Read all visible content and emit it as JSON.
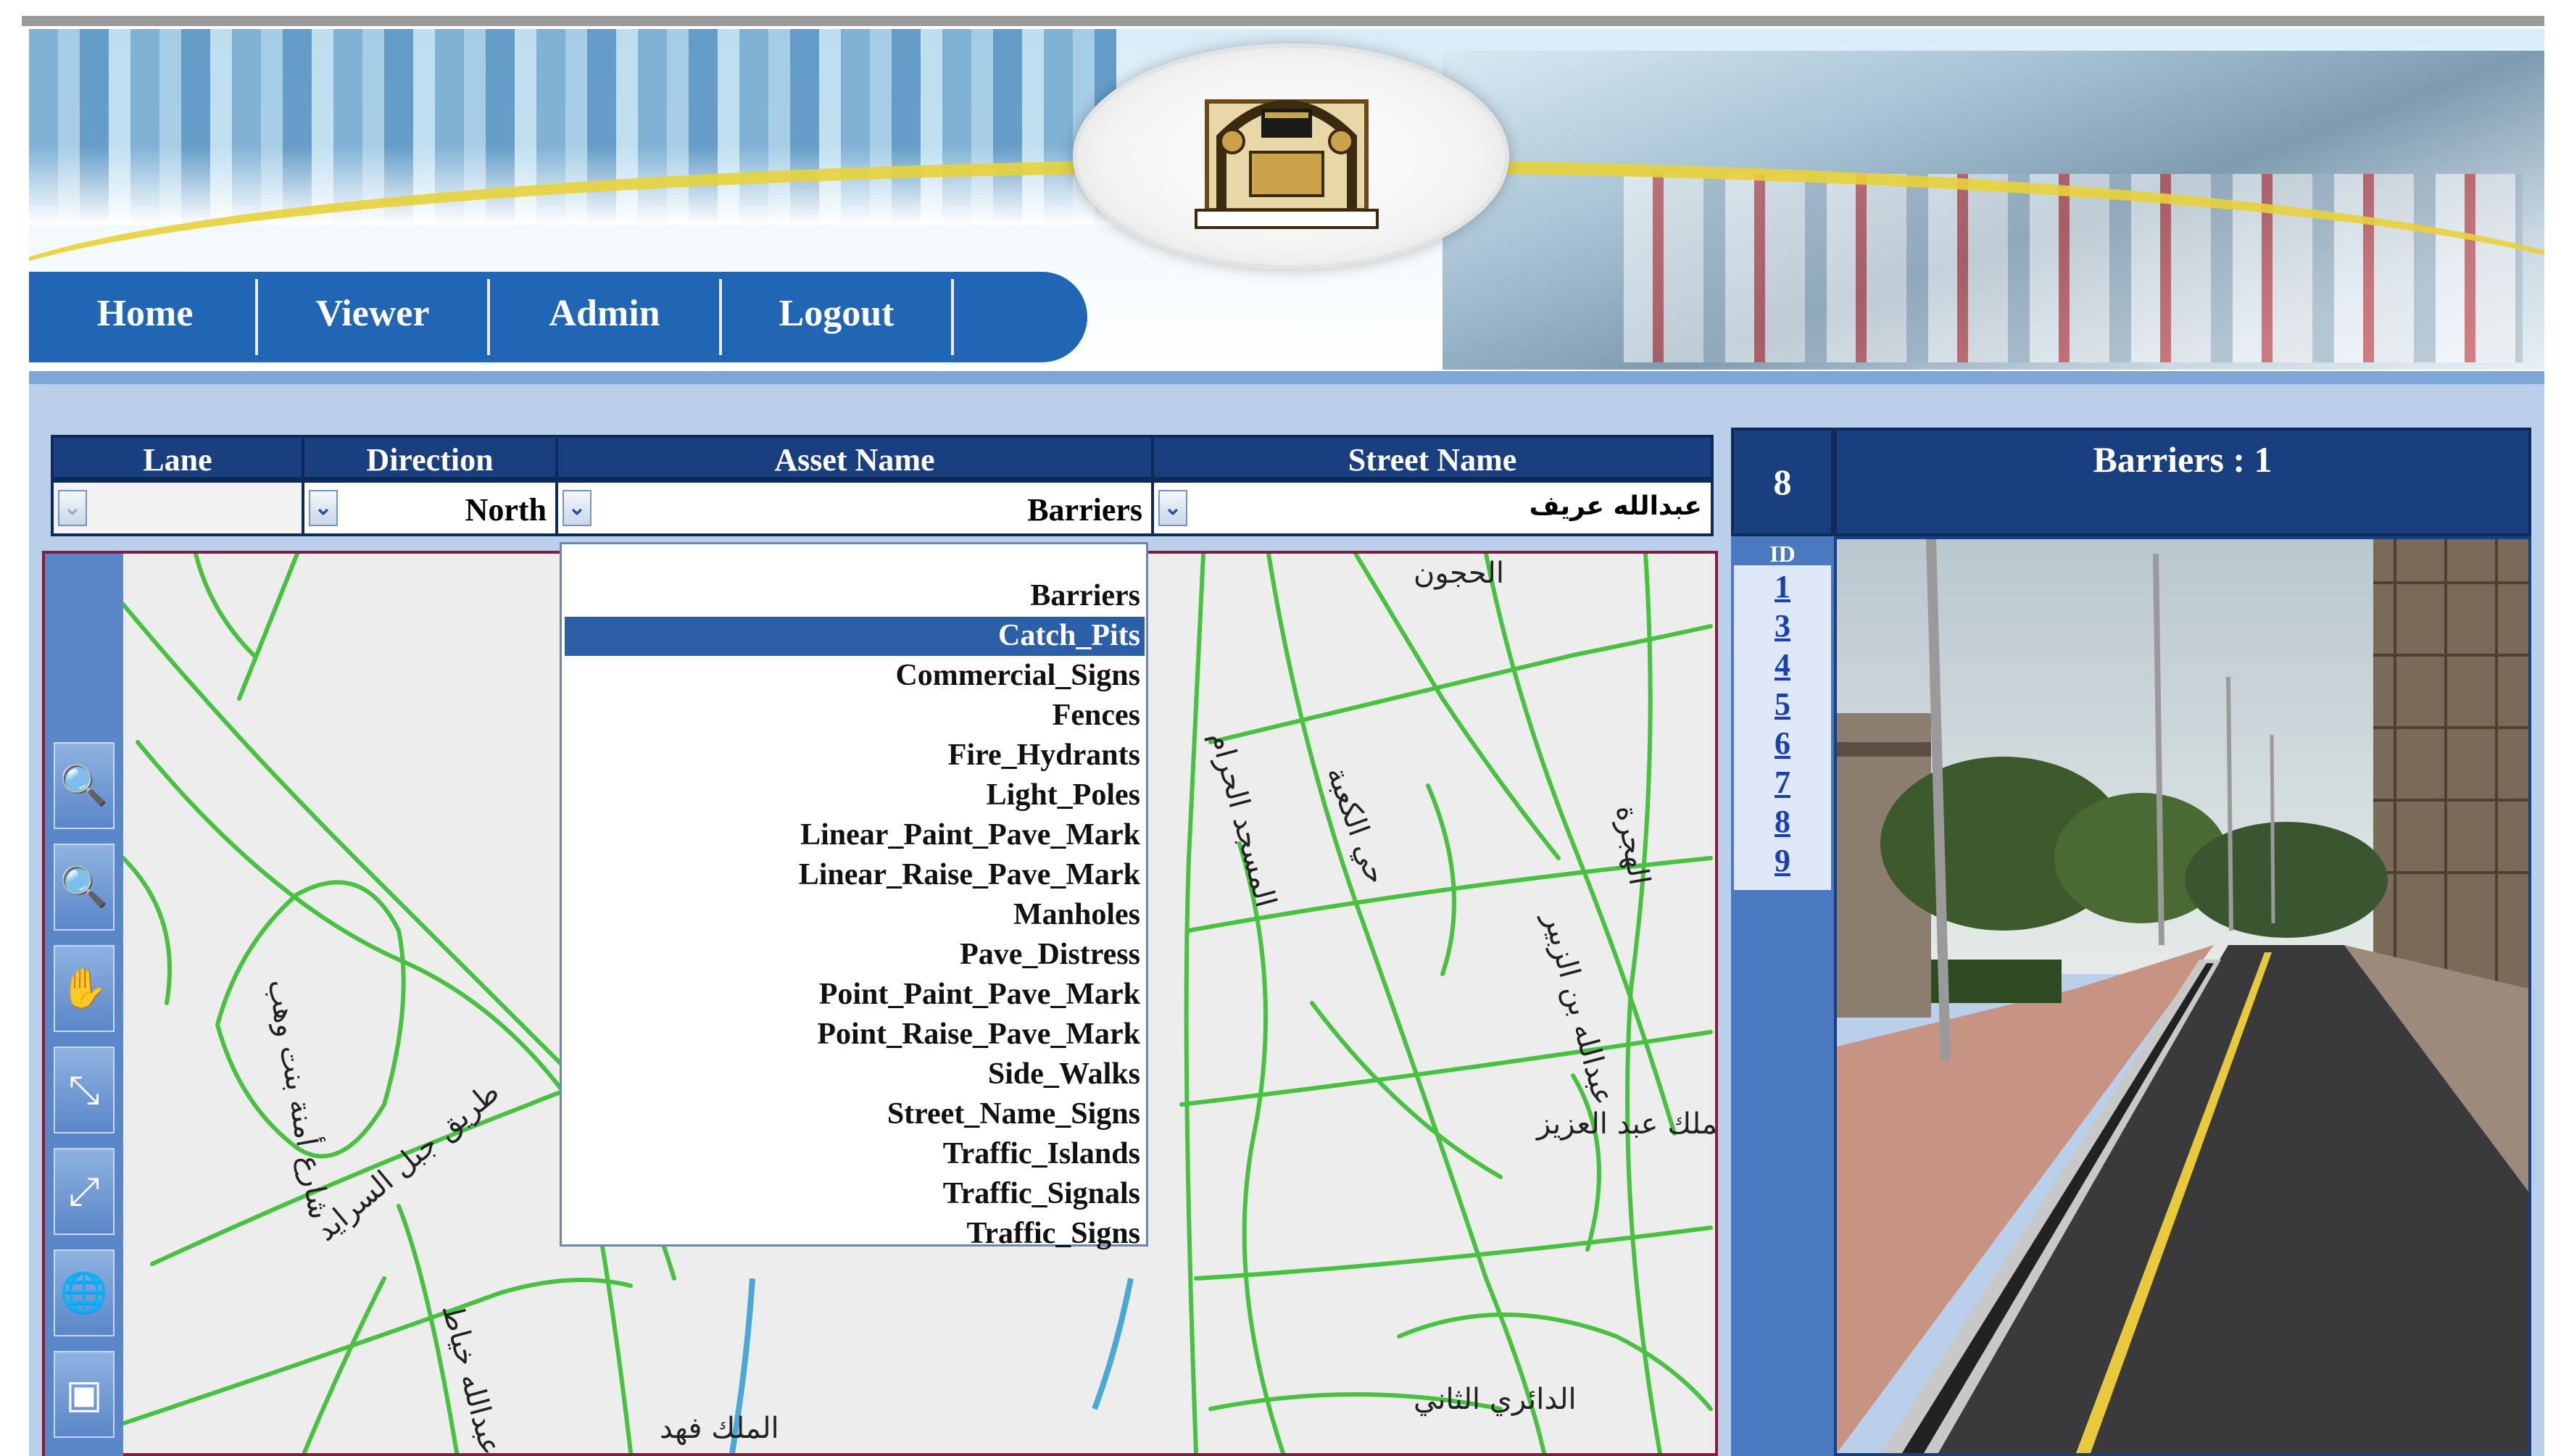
{
  "nav": {
    "items": [
      "Home",
      "Viewer",
      "Admin",
      "Logout"
    ]
  },
  "filters": {
    "lane": {
      "header": "Lane",
      "value": ""
    },
    "direction": {
      "header": "Direction",
      "value": "North"
    },
    "asset": {
      "header": "Asset Name",
      "value": "Barriers"
    },
    "street": {
      "header": "Street Name",
      "value": "عبدالله عريف"
    }
  },
  "asset_dropdown": {
    "options": [
      "Barriers",
      "Catch_Pits",
      "Commercial_Signs",
      "Fences",
      "Fire_Hydrants",
      "Light_Poles",
      "Linear_Paint_Pave_Mark",
      "Linear_Raise_Pave_Mark",
      "Manholes",
      "Pave_Distress",
      "Point_Paint_Pave_Mark",
      "Point_Raise_Pave_Mark",
      "Side_Walks",
      "Street_Name_Signs",
      "Traffic_Islands",
      "Traffic_Signals",
      "Traffic_Signs"
    ],
    "highlighted": "Catch_Pits"
  },
  "map": {
    "toolbar_icons": [
      "zoom-in-icon",
      "zoom-out-icon",
      "pan-hand-icon",
      "zoom-extent-in-icon",
      "zoom-extent-out-icon",
      "globe-icon",
      "select-box-icon"
    ],
    "labels": [
      "الحجون",
      "المسجد الحرام",
      "حي الكعبة",
      "الهجرة",
      "عبدالله بن الزبير",
      "الملك عبد العزيز",
      "طريق جبل السرايد",
      "عبدالله خياط",
      "شارع أمنة بنت وهب",
      "الدائري الثاني",
      "الملك فهد"
    ]
  },
  "results": {
    "count": "8",
    "title": "Barriers : 1",
    "id_label": "ID",
    "ids": [
      "1",
      "3",
      "4",
      "5",
      "6",
      "7",
      "8",
      "9"
    ]
  },
  "colors": {
    "nav_bg": "#2066b4",
    "header_bg": "#1a3f7e",
    "road": "#3fbf3a",
    "highlight": "#2c5fa8"
  }
}
